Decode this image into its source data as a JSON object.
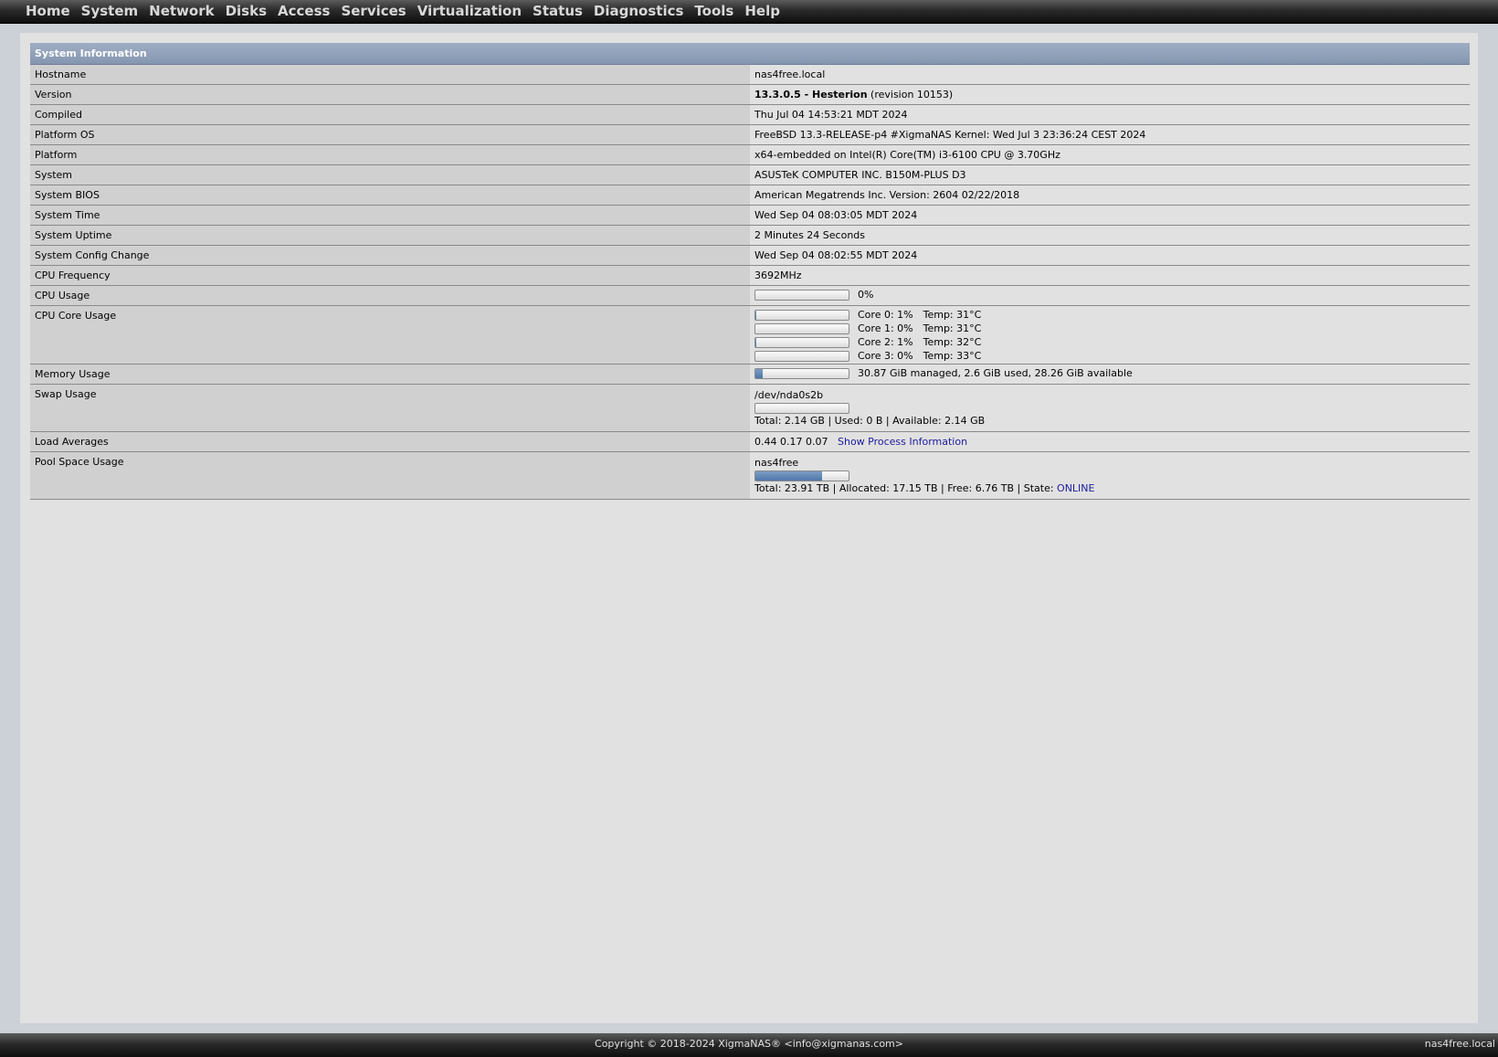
{
  "nav": [
    "Home",
    "System",
    "Network",
    "Disks",
    "Access",
    "Services",
    "Virtualization",
    "Status",
    "Diagnostics",
    "Tools",
    "Help"
  ],
  "sysinfo": {
    "title": "System Information",
    "hostname": {
      "label": "Hostname",
      "value": "nas4free.local"
    },
    "version": {
      "label": "Version",
      "value_bold": "13.3.0.5 - Hesterion",
      "value_rest": " (revision 10153)"
    },
    "compiled": {
      "label": "Compiled",
      "value": "Thu Jul 04 14:53:21 MDT 2024"
    },
    "platform_os": {
      "label": "Platform OS",
      "value": "FreeBSD 13.3-RELEASE-p4 #XigmaNAS Kernel: Wed Jul 3 23:36:24 CEST 2024"
    },
    "platform": {
      "label": "Platform",
      "value": "x64-embedded on Intel(R) Core(TM) i3-6100 CPU @ 3.70GHz"
    },
    "system": {
      "label": "System",
      "value": "ASUSTeK COMPUTER INC. B150M-PLUS D3"
    },
    "bios": {
      "label": "System BIOS",
      "value": "American Megatrends Inc. Version: 2604 02/22/2018"
    },
    "time": {
      "label": "System Time",
      "value": "Wed Sep 04 08:03:05 MDT 2024"
    },
    "uptime": {
      "label": "System Uptime",
      "value": "2 Minutes 24 Seconds"
    },
    "config_change": {
      "label": "System Config Change",
      "value": "Wed Sep 04 08:02:55 MDT 2024"
    },
    "cpu_freq": {
      "label": "CPU Frequency",
      "value": "3692MHz"
    },
    "cpu_usage": {
      "label": "CPU Usage",
      "text": "0%",
      "percent": 0
    },
    "cpu_cores": {
      "label": "CPU Core Usage",
      "cores": [
        {
          "text": "Core 0: 1%",
          "temp": "Temp: 31°C",
          "percent": 1
        },
        {
          "text": "Core 1: 0%",
          "temp": "Temp: 31°C",
          "percent": 0
        },
        {
          "text": "Core 2: 1%",
          "temp": "Temp: 32°C",
          "percent": 1
        },
        {
          "text": "Core 3: 0%",
          "temp": "Temp: 33°C",
          "percent": 0
        }
      ]
    },
    "memory": {
      "label": "Memory Usage",
      "text": "30.87 GiB managed, 2.6 GiB used, 28.26 GiB available",
      "percent": 8
    },
    "swap": {
      "label": "Swap Usage",
      "device": "/dev/nda0s2b",
      "text": "Total: 2.14 GB | Used: 0 B | Available: 2.14 GB",
      "percent": 0
    },
    "load": {
      "label": "Load Averages",
      "value": "0.44 0.17 0.07",
      "link": "Show Process Information"
    },
    "pool": {
      "label": "Pool Space Usage",
      "name": "nas4free",
      "text": "Total: 23.91 TB | Allocated: 17.15 TB | Free: 6.76 TB | State: ",
      "state": "ONLINE",
      "percent": 72
    }
  },
  "footer": {
    "copyright": "Copyright © 2018-2024 XigmaNAS® <info@xigmanas.com>",
    "host": "nas4free.local"
  },
  "colors": {
    "bar_fill": "#4f77a8",
    "header_bg": "#8a9ab4",
    "link": "#1c1c9c"
  }
}
